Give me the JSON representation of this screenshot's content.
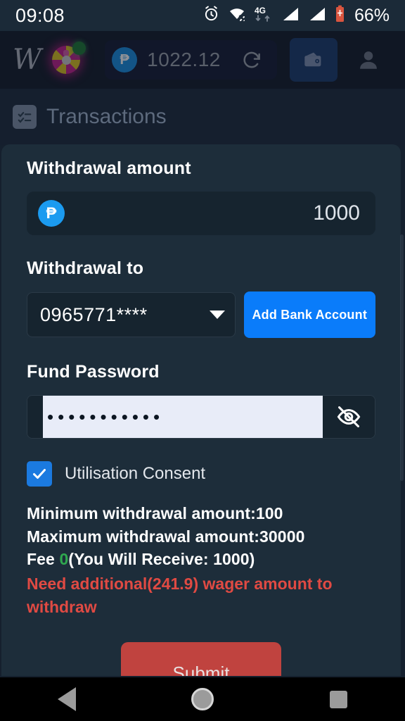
{
  "status_bar": {
    "time": "09:08",
    "battery_percent": "66%",
    "network_type": "4G",
    "icons": [
      "alarm-icon",
      "wifi-off-icon",
      "data-4g-icon",
      "signal-1-icon",
      "signal-2-icon",
      "battery-icon"
    ]
  },
  "header": {
    "logo": "W",
    "wheel_icon": "spin-wheel-icon",
    "balance": "1022.12",
    "currency_icon": "peso-coin-icon",
    "refresh_icon": "refresh-icon",
    "wallet_icon": "wallet-icon",
    "profile_icon": "user-avatar-icon"
  },
  "page": {
    "title": "Transactions",
    "title_icon": "checklist-icon"
  },
  "form": {
    "amount_label": "Withdrawal amount",
    "amount_value": "1000",
    "amount_currency_icon": "peso-coin-icon",
    "withdrawal_to_label": "Withdrawal to",
    "bank_account_value": "0965771****",
    "add_bank_button": "Add Bank Account",
    "password_label": "Fund Password",
    "password_value": "•••••••••••",
    "password_toggle_icon": "eye-off-icon",
    "consent_label": "Utilisation Consent",
    "consent_checked": true,
    "submit_button": "Submit"
  },
  "info": {
    "minimum": "Minimum withdrawal amount:100",
    "maximum": "Maximum withdrawal amount:30000",
    "fee_prefix": "Fee ",
    "fee_value": "0",
    "fee_suffix": "(You Will Receive: 1000)",
    "warning": "Need additional(241.9) wager amount to withdraw"
  },
  "colors": {
    "accent_blue": "#0a7cfa",
    "submit_red": "#c0433f",
    "warning_red": "#e04a43",
    "fee_green": "#2fa84f",
    "card_bg": "#1d2d3a"
  },
  "navigation_bar": {
    "back_icon": "back-triangle-icon",
    "home_icon": "home-circle-icon",
    "recents_icon": "recents-square-icon"
  }
}
